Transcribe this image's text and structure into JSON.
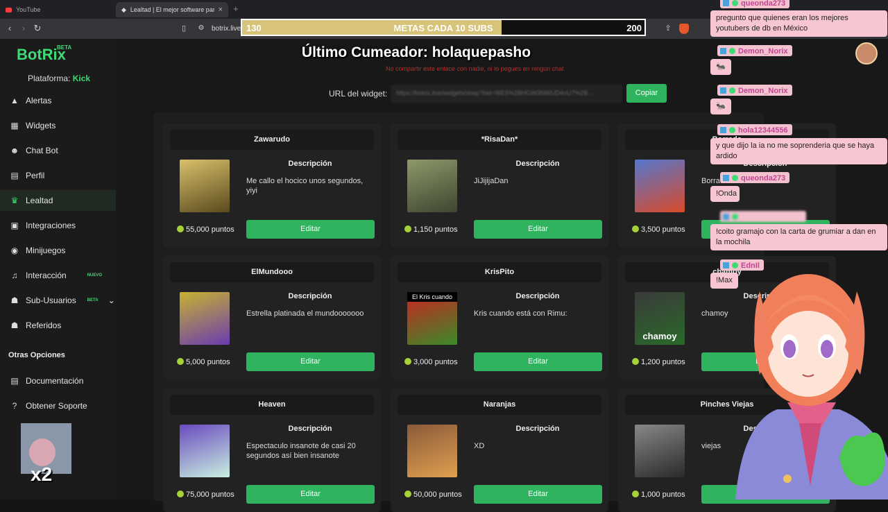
{
  "browser": {
    "tabs": [
      {
        "title": "YouTube",
        "active": false
      },
      {
        "title": "Lealtad | El mejor software para ...",
        "active": true
      }
    ],
    "new_tab": "+",
    "url": "botrix.live/"
  },
  "goal_bar": {
    "start": "130",
    "title": "METAS CADA 10 SUBS",
    "end": "200",
    "progress": 0.645,
    "fill_color": "#d7c37a"
  },
  "overlay_title": "Último Cumeador: holaquepasho",
  "app": {
    "logo": "BotRix",
    "logo_badge": "BETA",
    "platform_label": "Plataforma:",
    "platform_value": "Kick",
    "accent_color": "#3ddb73"
  },
  "sidebar": {
    "items": [
      {
        "label": "Alertas",
        "icon": "warning-icon",
        "glyph": "▲"
      },
      {
        "label": "Widgets",
        "icon": "grid-icon",
        "glyph": "▦"
      },
      {
        "label": "Chat Bot",
        "icon": "robot-icon",
        "glyph": "☻"
      },
      {
        "label": "Perfil",
        "icon": "profile-card-icon",
        "glyph": "▤"
      },
      {
        "label": "Lealtad",
        "icon": "trophy-icon",
        "glyph": "♛",
        "active": true
      },
      {
        "label": "Integraciones",
        "icon": "integrations-icon",
        "glyph": "▣"
      },
      {
        "label": "Minijuegos",
        "icon": "gamepad-icon",
        "glyph": "◉"
      },
      {
        "label": "Interacción",
        "icon": "music-icon",
        "glyph": "♫",
        "badge": "NUEVO"
      },
      {
        "label": "Sub-Usuarios",
        "icon": "users-icon",
        "glyph": "☗",
        "badge": "BETA",
        "chevron": "⌄"
      },
      {
        "label": "Referidos",
        "icon": "referrals-icon",
        "glyph": "☗"
      }
    ],
    "section_title": "Otras Opciones",
    "other_items": [
      {
        "label": "Documentación",
        "icon": "docs-icon",
        "glyph": "▤"
      },
      {
        "label": "Obtener Soporte",
        "icon": "help-icon",
        "glyph": "?"
      }
    ]
  },
  "widget": {
    "warning": "No compartir este enlace con nadie, ni lo pegues en ningún chat",
    "url_label": "URL del widget:",
    "url_value": "https://botrix.live/widgets/shop?bid=WE5%2BHGW3NWUD4nU7%2B...",
    "copy_label": "Copiar"
  },
  "cards": [
    {
      "title": "Zawarudo",
      "desc_heading": "Descripción",
      "desc": "Me callo el hocico unos segundos, yiyi",
      "points": "55,000 puntos",
      "button": "Editar",
      "img_colors": [
        "#d9c06a",
        "#5a4a1e"
      ]
    },
    {
      "title": "*RisaDan*",
      "desc_heading": "Descripción",
      "desc": "JiJijijaDan",
      "points": "1,150 puntos",
      "button": "Editar",
      "img_colors": [
        "#8c9a6a",
        "#3d4530"
      ]
    },
    {
      "title": "Borrado",
      "desc_heading": "Descripción",
      "desc": "Borra...",
      "points": "3,500 puntos",
      "button": "Editar",
      "img_colors": [
        "#5577cc",
        "#d94a2a"
      ]
    },
    {
      "title": "ElMundooo",
      "desc_heading": "Descripción",
      "desc": "Estrella platinada el mundooooooo",
      "points": "5,000 puntos",
      "button": "Editar",
      "img_colors": [
        "#c7b230",
        "#6a3bb0"
      ]
    },
    {
      "title": "KrisPito",
      "desc_heading": "Descripción",
      "desc": "Kris cuando está con Rimu:",
      "points": "3,000 puntos",
      "button": "Editar",
      "img_colors": [
        "#cc2222",
        "#3a8a2a"
      ],
      "img_caption": "El Kris cuando"
    },
    {
      "title": "chamoy",
      "desc_heading": "Descripción",
      "desc": "chamoy",
      "points": "1,200 puntos",
      "button": "Editar",
      "img_colors": [
        "#3a3a3a",
        "#2a6a2a"
      ],
      "img_overlay": "chamoy"
    },
    {
      "title": "Heaven",
      "desc_heading": "Descripción",
      "desc": "Espectaculo insanote de casi 20 segundos así bien insanote",
      "points": "75,000 puntos",
      "button": "Editar",
      "img_colors": [
        "#6a4ac0",
        "#c9f0e0"
      ]
    },
    {
      "title": "Naranjas",
      "desc_heading": "Descripción",
      "desc": "XD",
      "points": "50,000 puntos",
      "button": "Editar",
      "img_colors": [
        "#8a5a3a",
        "#e0a050"
      ]
    },
    {
      "title": "Pinches Viejas",
      "desc_heading": "Descripción",
      "desc": "viejas",
      "points": "1,000 puntos",
      "button": "Editar",
      "img_colors": [
        "#888888",
        "#2a2a2a"
      ]
    }
  ],
  "chat": [
    {
      "user": "queonda273",
      "msg": "pregunto que quienes eran los mejores youtubers de db en México"
    },
    {
      "user": "Demon_Norix",
      "msg": "🐜"
    },
    {
      "user": "Demon_Norix",
      "msg": "🐜"
    },
    {
      "user": "hola12344556",
      "msg": "y que dijo la ia no me soprenderia que se haya ardido"
    },
    {
      "user": "queonda273",
      "msg": "!Onda"
    },
    {
      "user": "",
      "msg": "!coito gramajo con la carta de grumiar a dan en la mochila"
    },
    {
      "user": "EdnIl",
      "msg": "!Max"
    }
  ],
  "stream_cam": {
    "label": "x2"
  }
}
